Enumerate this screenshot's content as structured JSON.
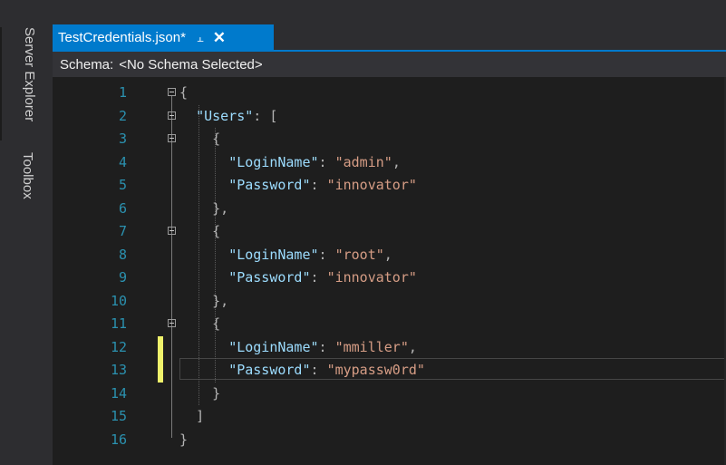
{
  "side_panel": {
    "server_explorer": "Server Explorer",
    "toolbox": "Toolbox"
  },
  "tab": {
    "title": "TestCredentials.json*",
    "pin_icon": "pin-icon",
    "close_icon": "close-icon"
  },
  "schema": {
    "label": "Schema:",
    "value": "<No Schema Selected>"
  },
  "editor": {
    "line_numbers": [
      "1",
      "2",
      "3",
      "4",
      "5",
      "6",
      "7",
      "8",
      "9",
      "10",
      "11",
      "12",
      "13",
      "14",
      "15",
      "16"
    ],
    "lines": [
      {
        "indent": "",
        "key": "",
        "sep": "",
        "value": "",
        "punct": "{"
      },
      {
        "indent": "  ",
        "key": "\"Users\"",
        "sep": ": ",
        "value": "",
        "punct": "["
      },
      {
        "indent": "    ",
        "key": "",
        "sep": "",
        "value": "",
        "punct": "{"
      },
      {
        "indent": "      ",
        "key": "\"LoginName\"",
        "sep": ": ",
        "value": "\"admin\"",
        "punct": ","
      },
      {
        "indent": "      ",
        "key": "\"Password\"",
        "sep": ": ",
        "value": "\"innovator\"",
        "punct": ""
      },
      {
        "indent": "    ",
        "key": "",
        "sep": "",
        "value": "",
        "punct": "},"
      },
      {
        "indent": "    ",
        "key": "",
        "sep": "",
        "value": "",
        "punct": "{"
      },
      {
        "indent": "      ",
        "key": "\"LoginName\"",
        "sep": ": ",
        "value": "\"root\"",
        "punct": ","
      },
      {
        "indent": "      ",
        "key": "\"Password\"",
        "sep": ": ",
        "value": "\"innovator\"",
        "punct": ""
      },
      {
        "indent": "    ",
        "key": "",
        "sep": "",
        "value": "",
        "punct": "},"
      },
      {
        "indent": "    ",
        "key": "",
        "sep": "",
        "value": "",
        "punct": "{"
      },
      {
        "indent": "      ",
        "key": "\"LoginName\"",
        "sep": ": ",
        "value": "\"mmiller\"",
        "punct": ","
      },
      {
        "indent": "      ",
        "key": "\"Password\"",
        "sep": ": ",
        "value": "\"mypassw0rd\"",
        "punct": ""
      },
      {
        "indent": "    ",
        "key": "",
        "sep": "",
        "value": "",
        "punct": "}"
      },
      {
        "indent": "  ",
        "key": "",
        "sep": "",
        "value": "",
        "punct": "]"
      },
      {
        "indent": "",
        "key": "",
        "sep": "",
        "value": "",
        "punct": "}"
      }
    ],
    "fold_lines": [
      1,
      2,
      3,
      7,
      11
    ],
    "changed_lines": [
      12,
      13
    ],
    "current_line": 13,
    "colors": {
      "line_number": "#2b91af",
      "key": "#9cdcfe",
      "string": "#d69d85",
      "change_marker": "#eff26b",
      "accent": "#007acc"
    }
  }
}
